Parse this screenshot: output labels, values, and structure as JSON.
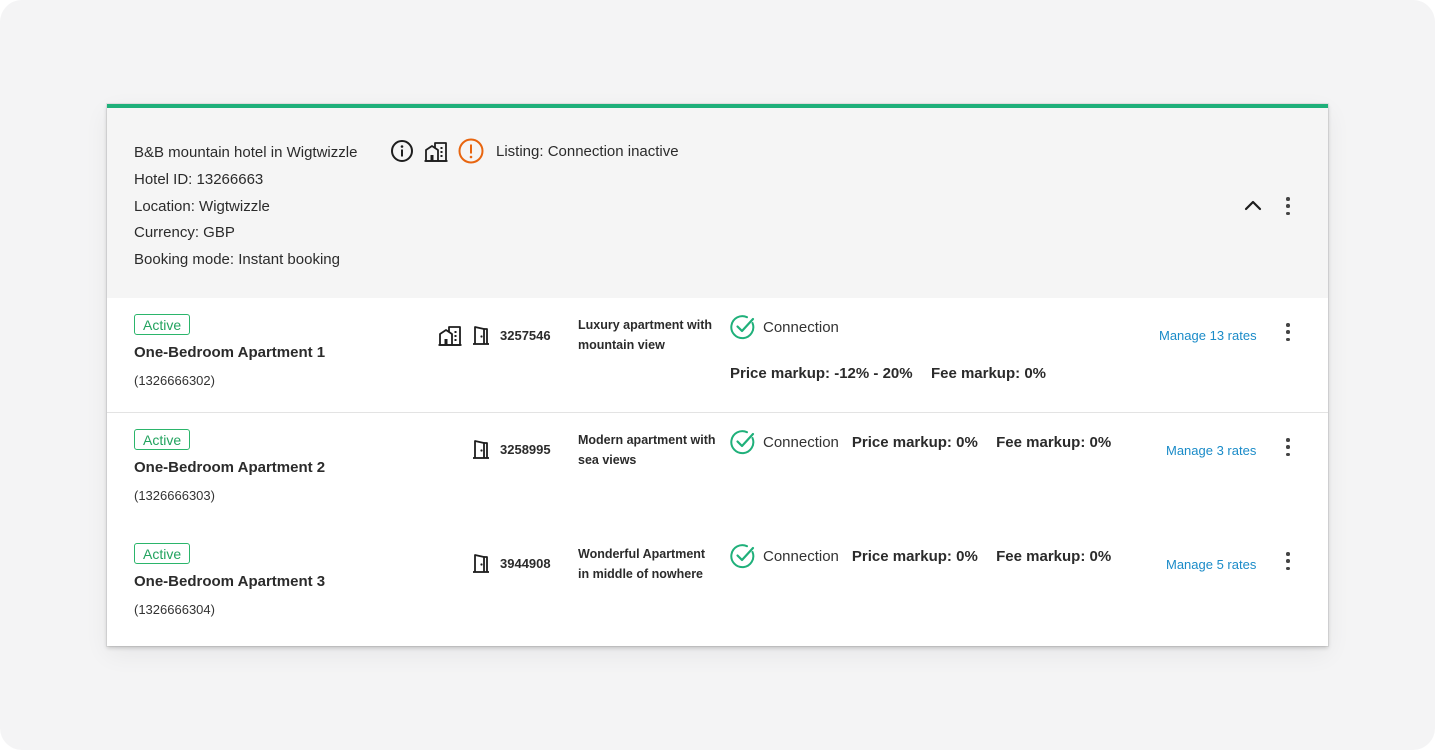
{
  "hotel": {
    "name": "B&B mountain hotel in Wigtwizzle",
    "hotel_id": "Hotel ID: 13266663",
    "location": "Location: Wigtwizzle",
    "currency": "Currency: GBP",
    "booking_mode": "Booking mode: Instant booking",
    "listing_status": "Listing: Connection inactive",
    "icons": [
      "info-icon",
      "building-icon",
      "warning-icon"
    ]
  },
  "colors": {
    "accent_top": "#1fb07a",
    "active_badge": "#23a35f",
    "warning": "#e8650f",
    "connection_check": "#1fb07a",
    "link": "#1a8bc8"
  },
  "rooms": [
    {
      "status": "Active",
      "name": "One-Bedroom Apartment 1",
      "room_id": "(1326666302)",
      "number": "3257546",
      "description": "Luxury apartment with mountain view",
      "connection": "Connection",
      "price_markup_label": "Price markup:",
      "price_markup_value": "-12% - 20%",
      "fee_markup_label": "Fee markup:",
      "fee_markup_value": "0%",
      "manage": "Manage 13 rates"
    },
    {
      "status": "Active",
      "name": "One-Bedroom Apartment 2",
      "room_id": "(1326666303)",
      "number": "3258995",
      "description": "Modern apartment with sea views",
      "connection": "Connection",
      "price_markup_label": "Price markup:",
      "price_markup_value": "0%",
      "fee_markup_label": "Fee markup:",
      "fee_markup_value": "0%",
      "manage": "Manage 3 rates"
    },
    {
      "status": "Active",
      "name": "One-Bedroom Apartment 3",
      "room_id": "(1326666304)",
      "number": "3944908",
      "description": "Wonderful Apartment in middle of nowhere",
      "connection": "Connection",
      "price_markup_label": "Price markup:",
      "price_markup_value": "0%",
      "fee_markup_label": "Fee markup:",
      "fee_markup_value": "0%",
      "manage": "Manage 5 rates"
    }
  ]
}
